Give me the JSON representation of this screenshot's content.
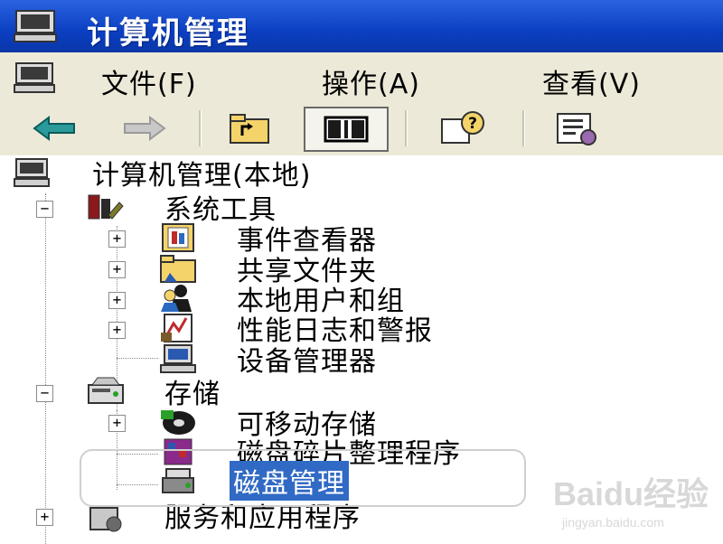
{
  "window": {
    "title": "计算机管理"
  },
  "menu": {
    "items": [
      "文件(F)",
      "操作(A)",
      "查看(V)"
    ]
  },
  "toolbar": {
    "buttons": [
      "back-arrow-icon",
      "forward-arrow-icon",
      "up-folder-icon",
      "show-hide-tree-icon",
      "help-icon",
      "properties-icon"
    ]
  },
  "tree": {
    "root": "计算机管理(本地)",
    "system_tools": "系统工具",
    "event_viewer": "事件查看器",
    "shared_folders": "共享文件夹",
    "local_users": "本地用户和组",
    "perf_logs": "性能日志和警报",
    "device_manager": "设备管理器",
    "storage": "存储",
    "removable_storage": "可移动存储",
    "defrag": "磁盘碎片整理程序",
    "disk_management": "磁盘管理",
    "services": "服务和应用程序"
  },
  "watermark": {
    "main": "Baidu经验",
    "sub": "jingyan.baidu.com"
  },
  "colors": {
    "titlebar": "#0b3fc2",
    "selection": "#316ac5",
    "chrome": "#ece9d8"
  }
}
